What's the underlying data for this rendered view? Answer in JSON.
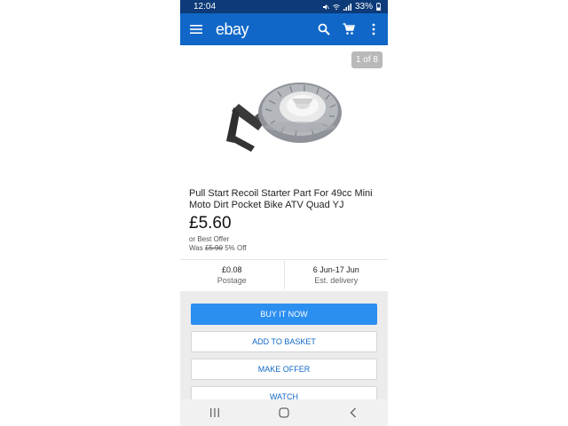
{
  "status_bar": {
    "time": "12:04",
    "battery": "33%"
  },
  "app_bar": {
    "logo": "ebay",
    "icons": [
      "menu-icon",
      "search-icon",
      "cart-icon",
      "more-icon"
    ]
  },
  "gallery": {
    "counter": "1 of 8"
  },
  "listing": {
    "title": "Pull Start Recoil Starter Part For 49cc Mini Moto Dirt Pocket Bike ATV Quad YJ",
    "price": "£5.60",
    "offer_text": "or Best Offer",
    "was_label": "Was",
    "was_price": "£5.90",
    "discount": "5% Off"
  },
  "shipping": {
    "postage_value": "£0.08",
    "postage_label": "Postage",
    "delivery_value": "6 Jun-17 Jun",
    "delivery_label": "Est. delivery"
  },
  "actions": {
    "buy_now": "BUY IT NOW",
    "add_to_basket": "ADD TO BASKET",
    "make_offer": "MAKE OFFER",
    "watch": "WATCH"
  },
  "colors": {
    "app_bar": "#1067c8",
    "status_bar": "#0d3a78",
    "primary_button": "#2b8ff0"
  }
}
